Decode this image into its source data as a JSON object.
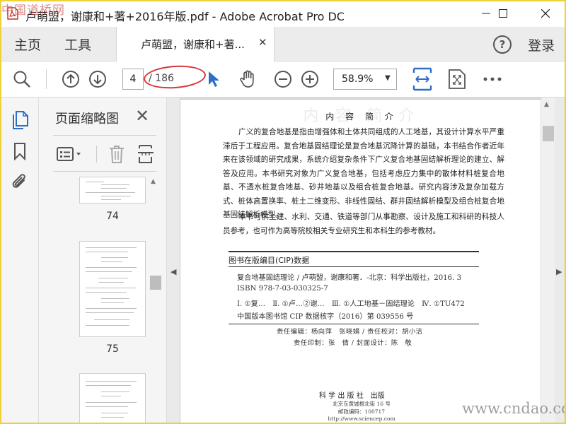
{
  "app": {
    "window_title": "卢萌盟，谢康和+著+2016年版.pdf - Adobe Acrobat Pro DC",
    "corner_watermark": "中国道桥网",
    "site_watermark": "www.cndao.com"
  },
  "menubar": {
    "home": "主页",
    "tools": "工具",
    "doc_tab": "卢萌盟，谢康和+著...",
    "login": "登录",
    "help": "?"
  },
  "toolbar": {
    "current_page": "4",
    "total_pages": "/ 186",
    "zoom": "58.9%"
  },
  "thumbnails": {
    "title": "页面缩略图",
    "pages": [
      "74",
      "75"
    ]
  },
  "document": {
    "ghost_heading": "内 容 简 介",
    "heading": "内 容 简 介",
    "para1": "广义的复合地基是指由增强体和土体共同组成的人工地基，其设计计算水平严重滞后于工程应用。复合地基固结理论是复合地基沉降计算的基础，本书结合作者近年来在该领域的研究成果，系统介绍复杂条件下广义复合地基固结解析理论的建立、解答及应用。本书研究对象为广义复合地基，包括考虑应力集中的散体材料桩复合地基、不透水桩复合地基、砂井地基以及组合桩复合地基。研究内容涉及复杂加载方式、桩体高置换率、桩土二维变形、非线性固结、群井固结解析模型及组合桩复合地基固结解析模型。",
    "para2": "本书可供土建、水利、交通、铁道等部门从事勘察、设计及施工和科研的科技人员参考，也可作为高等院校相关专业研究生和本科生的参考教材。",
    "cip_title": "图书在版编目(CIP)数据",
    "cip_lines": [
      "复合地基固结理论 / 卢萌盟，谢康和著．-北京：科学出版社，2016. 3",
      "ISBN 978-7-03-030325-7",
      "Ⅰ. ①复…　Ⅱ. ①卢…②谢…　Ⅲ. ①人工地基－固结理论　Ⅳ. ①TU472",
      "中国版本图书馆 CIP 数据核字（2016）第 039556 号"
    ],
    "credit1": "责任编辑：杨向萍　张晓娟 / 责任校对：胡小洁",
    "credit2": "责任印制：张　倩 / 封面设计：陈　敬",
    "publisher": "科 学 出 版 社　出版",
    "address1": "北京东黄城根北街 16 号",
    "address2": "邮政编码：100717",
    "address3": "http://www.sciencep.com"
  }
}
